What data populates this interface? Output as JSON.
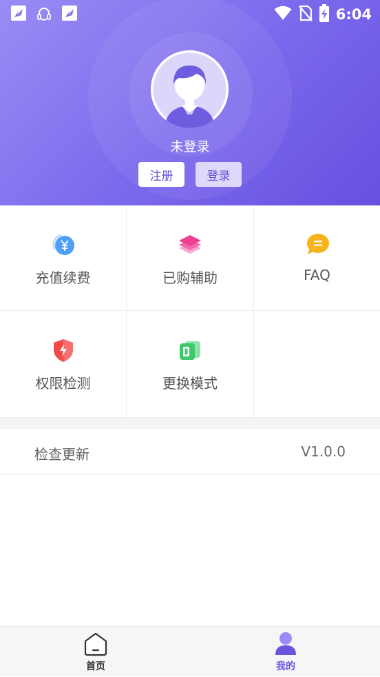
{
  "status_bar": {
    "time": "6:04",
    "left_icons": [
      "app-notification-icon",
      "headset-notification-icon",
      "app-notification-icon"
    ],
    "right_icons": [
      "wifi-icon",
      "no-sim-icon",
      "battery-charging-icon"
    ]
  },
  "profile": {
    "avatar": "default-user-avatar",
    "username": "未登录",
    "register_label": "注册",
    "login_label": "登录"
  },
  "menu": [
    {
      "label": "充值续费",
      "icon": "recharge-yuan-icon",
      "color": "#4e9ff7"
    },
    {
      "label": "已购辅助",
      "icon": "layers-icon",
      "color": "#f0449a"
    },
    {
      "label": "FAQ",
      "icon": "chat-bubble-icon",
      "color": "#f7b21c"
    },
    {
      "label": "权限检测",
      "icon": "shield-icon",
      "color": "#f04a4a"
    },
    {
      "label": "更换模式",
      "icon": "switch-mode-icon",
      "color": "#3ec96b"
    }
  ],
  "update": {
    "label": "检查更新",
    "version": "V1.0.0"
  },
  "bottom_nav": {
    "home_label": "首页",
    "mine_label": "我的",
    "active": "我的"
  },
  "colors": {
    "accent": "#6a55dc",
    "header_gradient_start": "#9a8cf5",
    "header_gradient_end": "#6650e0"
  }
}
